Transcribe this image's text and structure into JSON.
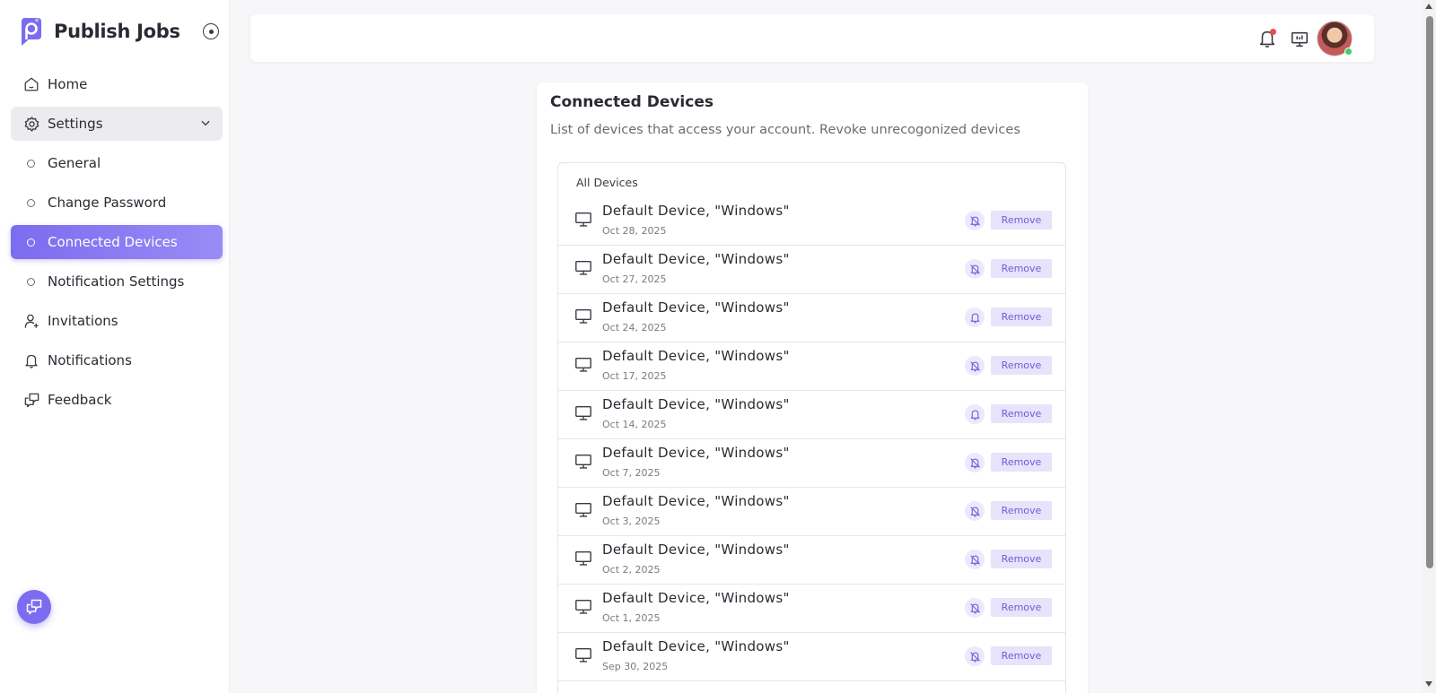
{
  "brand": {
    "name": "Publish Jobs"
  },
  "sidebar": {
    "items": [
      {
        "id": "home",
        "label": "Home",
        "icon": "home-icon"
      },
      {
        "id": "settings",
        "label": "Settings",
        "icon": "gear-icon"
      },
      {
        "id": "general",
        "label": "General"
      },
      {
        "id": "change-password",
        "label": "Change Password"
      },
      {
        "id": "connected-devices",
        "label": "Connected Devices"
      },
      {
        "id": "notification-settings",
        "label": "Notification Settings"
      },
      {
        "id": "invitations",
        "label": "Invitations",
        "icon": "user-plus-icon"
      },
      {
        "id": "notifications",
        "label": "Notifications",
        "icon": "bell-icon"
      },
      {
        "id": "feedback",
        "label": "Feedback",
        "icon": "feedback-icon"
      }
    ]
  },
  "colors": {
    "accent": "#7c6cf0",
    "remove_bg": "#e6e3fb",
    "remove_text": "#6a5fd6",
    "badge": "#ea4d4d",
    "online": "#3ecf6a"
  },
  "card": {
    "title": "Connected Devices",
    "subtitle": "List of devices that access your account. Revoke unrecogonized devices",
    "list_header": "All Devices",
    "remove_label": "Remove"
  },
  "devices": [
    {
      "name": "Default Device, \"Windows\"",
      "date": "Oct 28, 2025",
      "notify": "off"
    },
    {
      "name": "Default Device, \"Windows\"",
      "date": "Oct 27, 2025",
      "notify": "off"
    },
    {
      "name": "Default Device, \"Windows\"",
      "date": "Oct 24, 2025",
      "notify": "on"
    },
    {
      "name": "Default Device, \"Windows\"",
      "date": "Oct 17, 2025",
      "notify": "off"
    },
    {
      "name": "Default Device, \"Windows\"",
      "date": "Oct 14, 2025",
      "notify": "on"
    },
    {
      "name": "Default Device, \"Windows\"",
      "date": "Oct 7, 2025",
      "notify": "off"
    },
    {
      "name": "Default Device, \"Windows\"",
      "date": "Oct 3, 2025",
      "notify": "off"
    },
    {
      "name": "Default Device, \"Windows\"",
      "date": "Oct 2, 2025",
      "notify": "off"
    },
    {
      "name": "Default Device, \"Windows\"",
      "date": "Oct 1, 2025",
      "notify": "off"
    },
    {
      "name": "Default Device, \"Windows\"",
      "date": "Sep 30, 2025",
      "notify": "off"
    }
  ]
}
